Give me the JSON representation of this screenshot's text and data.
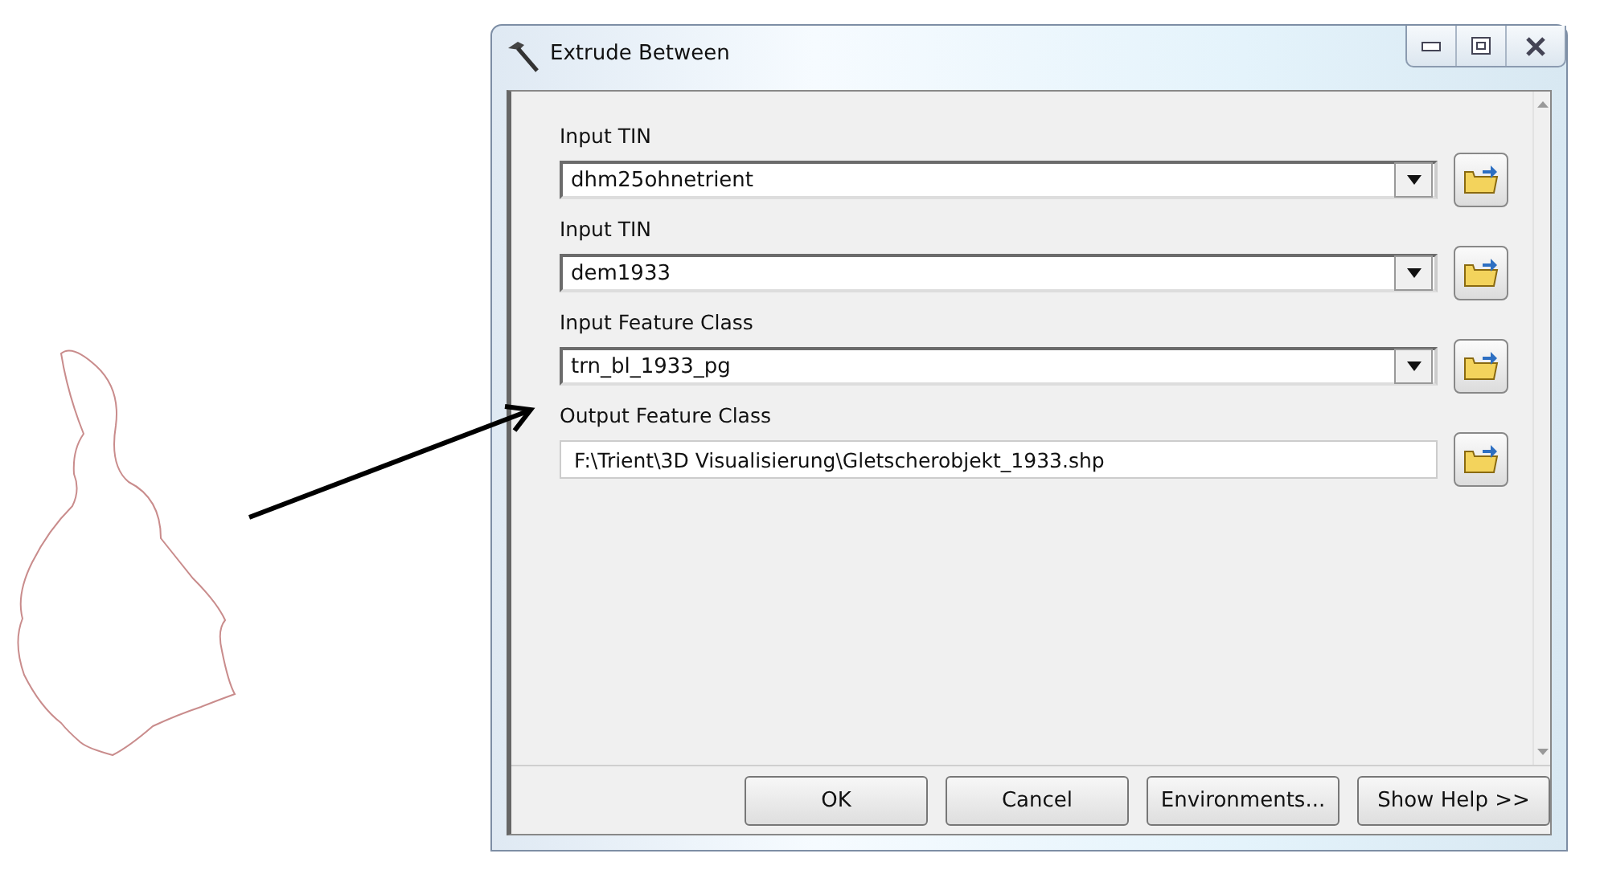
{
  "window": {
    "title": "Extrude Between"
  },
  "fields": [
    {
      "kind": "combo",
      "label": "Input TIN",
      "value": "dhm25ohnetrient"
    },
    {
      "kind": "combo",
      "label": "Input TIN",
      "value": "dem1933"
    },
    {
      "kind": "combo",
      "label": "Input Feature Class",
      "value": "trn_bl_1933_pg"
    },
    {
      "kind": "text",
      "label": "Output Feature Class",
      "value": "F:\\Trient\\3D Visualisierung\\Gletscherobjekt_1933.shp"
    }
  ],
  "buttons": [
    "OK",
    "Cancel",
    "Environments...",
    "Show Help >>"
  ]
}
